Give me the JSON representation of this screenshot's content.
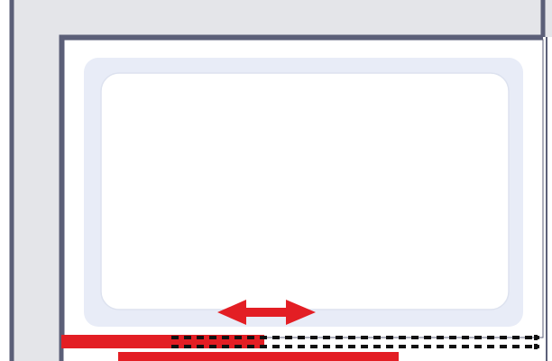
{
  "diagram": {
    "type": "sliding-bath-screen-plan",
    "elements": [
      "wall-corner",
      "bathtub",
      "fixed-panel",
      "sliding-panel",
      "sliding-track",
      "slide-arrow"
    ]
  },
  "colors": {
    "wall_fill": "#e4e5e9",
    "wall_border": "#5b5f78",
    "tub_rim": "#e8ecf7",
    "tub_basin": "#ffffff",
    "tub_basin_border": "#dde2ef",
    "panel_red": "#e31e24",
    "track_dash": "#111111",
    "background": "#ffffff"
  }
}
